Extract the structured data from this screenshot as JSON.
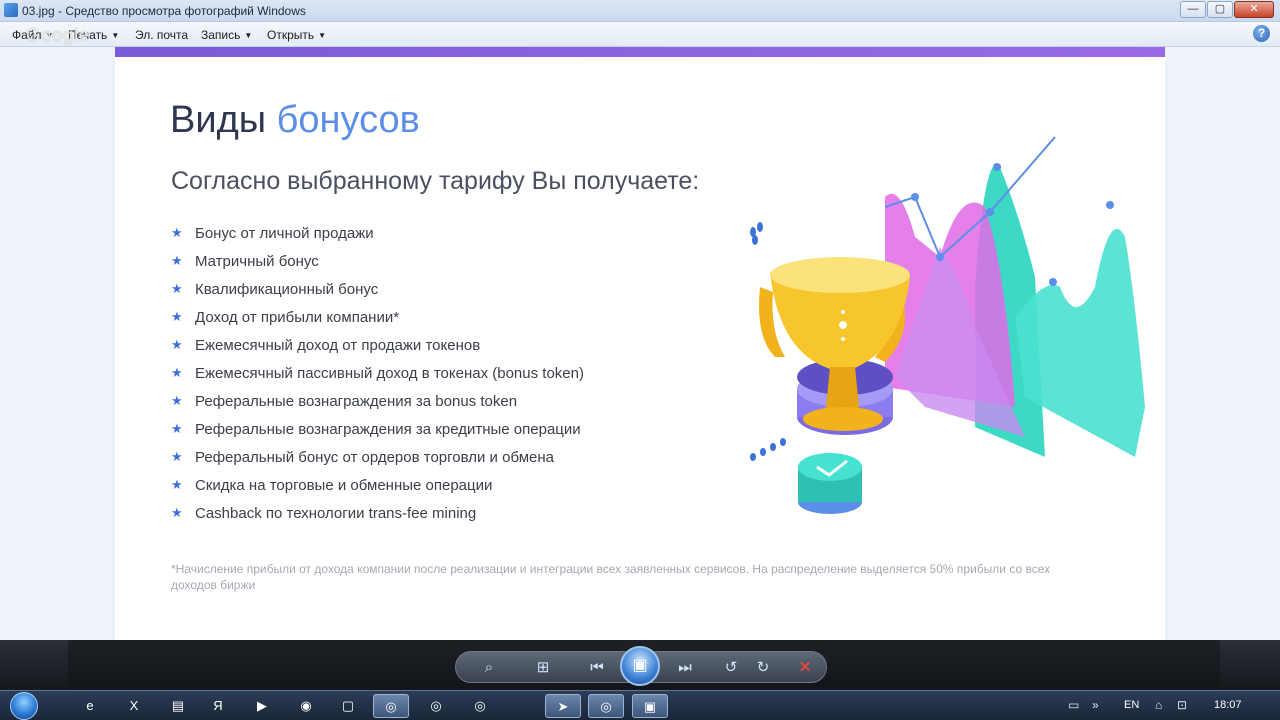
{
  "window": {
    "title": "03.jpg - Средство просмотра фотографий Windows",
    "buttons": {
      "minimize": "—",
      "maximize": "▢",
      "close": "✕"
    }
  },
  "menubar": {
    "items": [
      {
        "label": "Файл",
        "icon": "chevron-down-icon"
      },
      {
        "label": "Печать",
        "icon": "chevron-down-icon"
      },
      {
        "label": "Эл. почта"
      },
      {
        "label": "Запись",
        "icon": "chevron-down-icon"
      },
      {
        "label": "Открыть",
        "icon": "chevron-down-icon"
      }
    ],
    "help": "?",
    "watermark": "Google"
  },
  "slide": {
    "title_main": "Виды ",
    "title_accent": "бонусов",
    "subtitle": "Согласно выбранному тарифу Вы получаете:",
    "bonuses": [
      "Бонус от личной продажи",
      "Матричный бонус",
      "Квалификационный бонус",
      "Доход от прибыли компании*",
      "Ежемесячный доход от продажи токенов",
      "Ежемесячный пассивный доход в токенах (bonus token)",
      "Реферальные вознаграждения за bonus token",
      "Реферальные вознаграждения за кредитные операции",
      "Реферальный бонус от ордеров торговли и обмена",
      "Скидка на торговые и обменные операции",
      "Cashback по технологии trans-fee mining"
    ],
    "footnote": "*Начисление прибыли от дохода компании после реализации и интеграции всех заявленных сервисов. На распределение выделяется 50% прибыли со всех доходов биржи",
    "colors": {
      "accent": "#5b8ee6",
      "topbar": "#7a5bd8",
      "star": "#3d72d8"
    }
  },
  "controls": [
    {
      "name": "zoom",
      "icon": "magnifier-icon",
      "glyph": "⌕"
    },
    {
      "name": "actual-size",
      "icon": "fit-window-icon",
      "glyph": "⊞"
    },
    {
      "name": "previous",
      "icon": "previous-icon",
      "glyph": "⏮"
    },
    {
      "name": "slideshow",
      "icon": "slideshow-icon",
      "glyph": "▣"
    },
    {
      "name": "next",
      "icon": "next-icon",
      "glyph": "⏭"
    },
    {
      "name": "rotate-left",
      "icon": "rotate-ccw-icon",
      "glyph": "↺"
    },
    {
      "name": "rotate-right",
      "icon": "rotate-cw-icon",
      "glyph": "↻"
    },
    {
      "name": "delete",
      "icon": "delete-icon",
      "glyph": "✕"
    }
  ],
  "taskbar": {
    "apps": [
      {
        "icon": "internet-explorer-icon",
        "glyph": "e"
      },
      {
        "icon": "excel-icon",
        "glyph": "X"
      },
      {
        "icon": "notepad-icon",
        "glyph": "▤"
      },
      {
        "icon": "yandex-icon",
        "glyph": "Я"
      },
      {
        "icon": "media-player-icon",
        "glyph": "▶"
      },
      {
        "icon": "firefox-icon",
        "glyph": "◉"
      },
      {
        "icon": "window-icon",
        "glyph": "▢"
      },
      {
        "icon": "chrome-icon",
        "glyph": "◎"
      },
      {
        "icon": "chrome-icon",
        "glyph": "◎"
      },
      {
        "icon": "chrome-icon",
        "glyph": "◎"
      },
      {
        "icon": "telegram-icon",
        "glyph": "➤"
      },
      {
        "icon": "chrome-icon",
        "glyph": "◎"
      },
      {
        "icon": "photo-viewer-icon",
        "glyph": "▣"
      }
    ],
    "lang": "EN",
    "clock": "18:07"
  }
}
